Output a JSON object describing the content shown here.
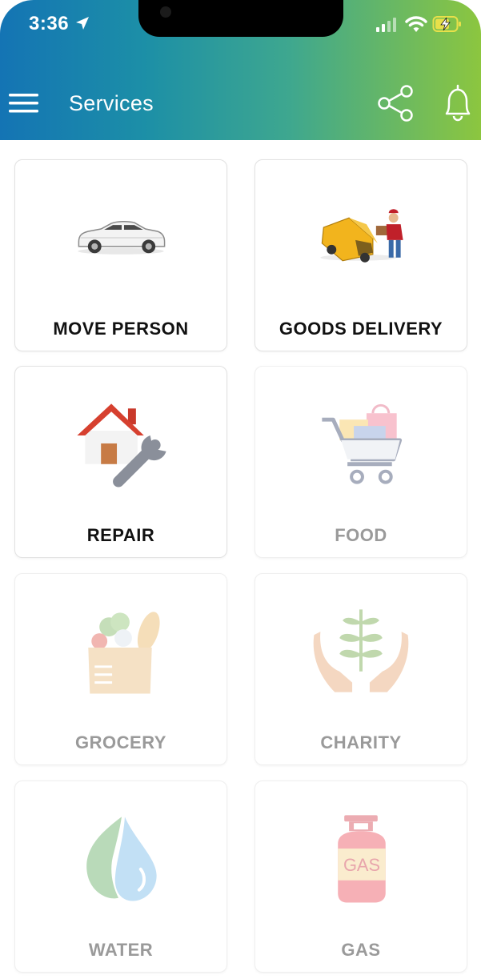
{
  "status_bar": {
    "time": "3:36"
  },
  "header": {
    "title": "Services"
  },
  "services": [
    {
      "label": "MOVE PERSON",
      "icon": "car-icon",
      "enabled": true
    },
    {
      "label": "GOODS DELIVERY",
      "icon": "delivery-van-icon",
      "enabled": true
    },
    {
      "label": "REPAIR",
      "icon": "house-repair-icon",
      "enabled": true
    },
    {
      "label": "FOOD",
      "icon": "shopping-cart-icon",
      "enabled": false
    },
    {
      "label": "GROCERY",
      "icon": "grocery-bag-icon",
      "enabled": false
    },
    {
      "label": "CHARITY",
      "icon": "hands-plant-icon",
      "enabled": false
    },
    {
      "label": "WATER",
      "icon": "water-drop-icon",
      "enabled": false
    },
    {
      "label": "GAS",
      "icon": "gas-cylinder-icon",
      "enabled": false,
      "art_text": "GAS"
    }
  ],
  "colors": {
    "header_gradient_start": "#1474b4",
    "header_gradient_end": "#8cc63f",
    "label_active": "#111111",
    "label_disabled": "#9a9a9a"
  }
}
